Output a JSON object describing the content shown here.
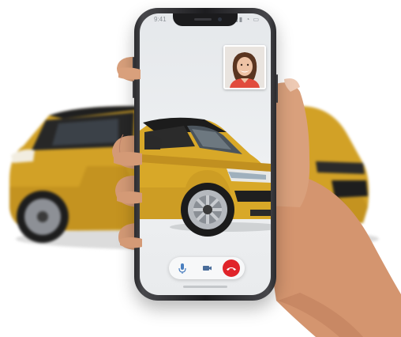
{
  "status_bar": {
    "time": "9:41",
    "indicators": "▮▮▮ ◔ ▭"
  },
  "video_call": {
    "remote_participant_icon": "person-thumbnail",
    "controls": [
      {
        "name": "mute",
        "icon": "microphone-icon"
      },
      {
        "name": "camera",
        "icon": "video-camera-icon"
      },
      {
        "name": "end-call",
        "icon": "phone-hangup-icon"
      }
    ],
    "end_call_color": "#e0242a"
  },
  "colors": {
    "car_body": "#d8a828",
    "car_roof": "#1c1c1c",
    "skin": "#d59a78"
  }
}
